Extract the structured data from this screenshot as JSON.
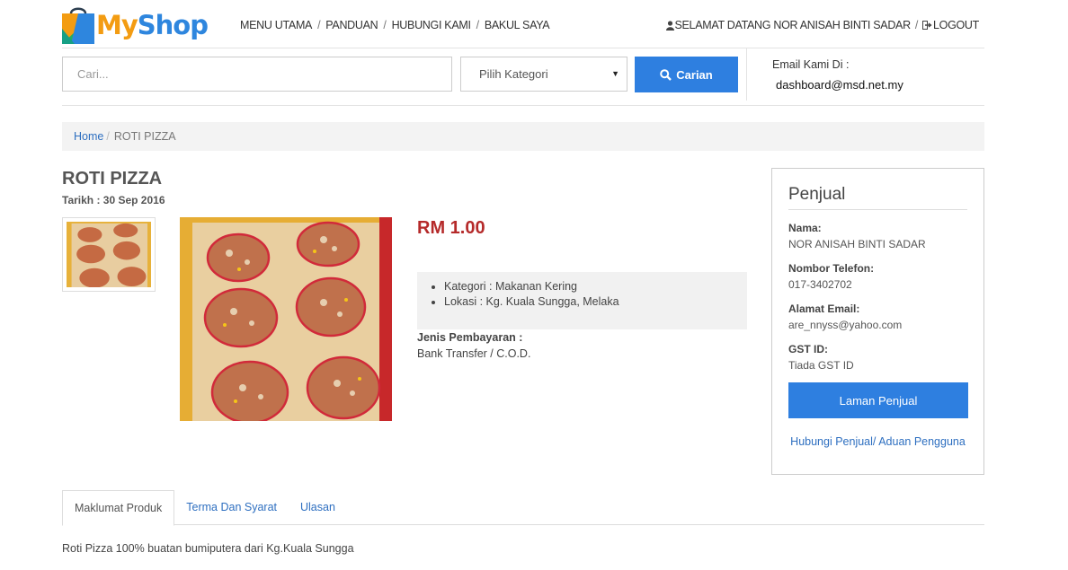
{
  "brand": {
    "name_part1": "My",
    "name_part2": "Shop",
    "color1": "#f39c12",
    "color2": "#2e86de"
  },
  "topnav": {
    "items": [
      "MENU UTAMA",
      "PANDUAN",
      "HUBUNGI KAMI",
      "BAKUL SAYA"
    ],
    "separator": "/"
  },
  "user": {
    "welcome": "SELAMAT DATANG NOR ANISAH BINTI SADAR",
    "logout": "LOGOUT",
    "icons": [
      "user-icon",
      "logout-icon"
    ]
  },
  "search": {
    "placeholder": "Cari...",
    "category_selected": "Pilih Kategori",
    "button_label": "Carian"
  },
  "contact": {
    "label": "Email Kami Di :",
    "email": "dashboard@msd.net.my"
  },
  "breadcrumb": {
    "home": "Home",
    "current": "ROTI PIZZA"
  },
  "product": {
    "title": "ROTI PIZZA",
    "date": "Tarikh : 30 Sep 2016",
    "price": "RM 1.00",
    "specs": [
      "Kategori : Makanan Kering",
      "Lokasi : Kg. Kuala Sungga, Melaka"
    ],
    "payment_label": "Jenis Pembayaran :",
    "payment_value": "Bank Transfer / C.O.D.",
    "description": "Roti Pizza 100% buatan bumiputera dari Kg.Kuala Sungga"
  },
  "seller": {
    "heading": "Penjual",
    "fields": [
      {
        "label": "Nama:",
        "value": "NOR ANISAH BINTI SADAR"
      },
      {
        "label": "Nombor Telefon:",
        "value": "017-3402702"
      },
      {
        "label": "Alamat Email:",
        "value": "are_nnyss@yahoo.com"
      },
      {
        "label": "GST ID:",
        "value": "Tiada GST ID"
      }
    ],
    "button_label": "Laman Penjual",
    "link_contact": "Hubungi Penjual",
    "link_report": "Aduan Pengguna",
    "link_separator": "/"
  },
  "tabs": [
    "Maklumat Produk",
    "Terma Dan Syarat",
    "Ulasan"
  ],
  "accent": "#2e7fe0",
  "price_color": "#b52a2a"
}
